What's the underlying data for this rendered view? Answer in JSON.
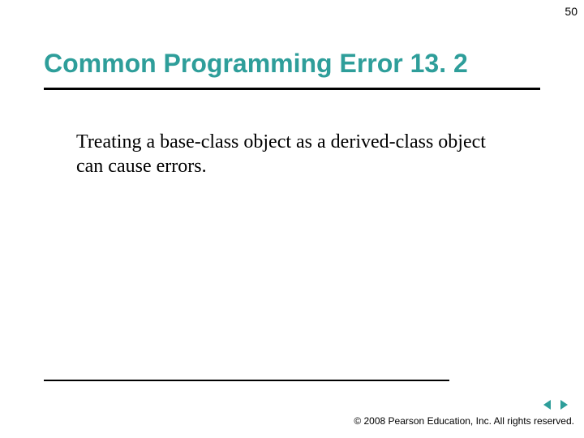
{
  "page_number": "50",
  "title": "Common Programming Error 13. 2",
  "body_text": "Treating a base-class object as a derived-class object can cause errors.",
  "footer": "© 2008 Pearson Education, Inc.  All rights reserved.",
  "colors": {
    "title": "#2e9e9a",
    "nav_arrow": "#2e9e9a"
  }
}
